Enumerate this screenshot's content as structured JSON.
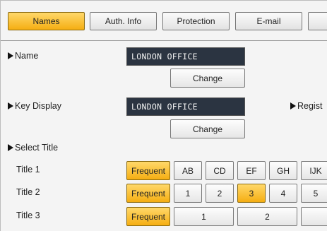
{
  "tabs": [
    {
      "label": "Names",
      "active": true
    },
    {
      "label": "Auth. Info",
      "active": false
    },
    {
      "label": "Protection",
      "active": false
    },
    {
      "label": "E-mail",
      "active": false
    },
    {
      "label": "",
      "active": false
    }
  ],
  "name": {
    "label": "Name",
    "value": "LONDON OFFICE",
    "change_label": "Change"
  },
  "key_display": {
    "label": "Key Display",
    "value": "LONDON OFFICE",
    "change_label": "Change"
  },
  "regist_label": "Regist",
  "select_title": {
    "label": "Select Title",
    "rows": [
      {
        "label": "Title 1",
        "frequent": "Frequent",
        "options": [
          "AB",
          "CD",
          "EF",
          "GH",
          "IJK"
        ]
      },
      {
        "label": "Title 2",
        "frequent": "Frequent",
        "options": [
          "1",
          "2",
          "3",
          "4",
          "5"
        ],
        "selected": "3"
      },
      {
        "label": "Title 3",
        "frequent": "Frequent",
        "options": [
          "1",
          "2"
        ]
      }
    ]
  }
}
